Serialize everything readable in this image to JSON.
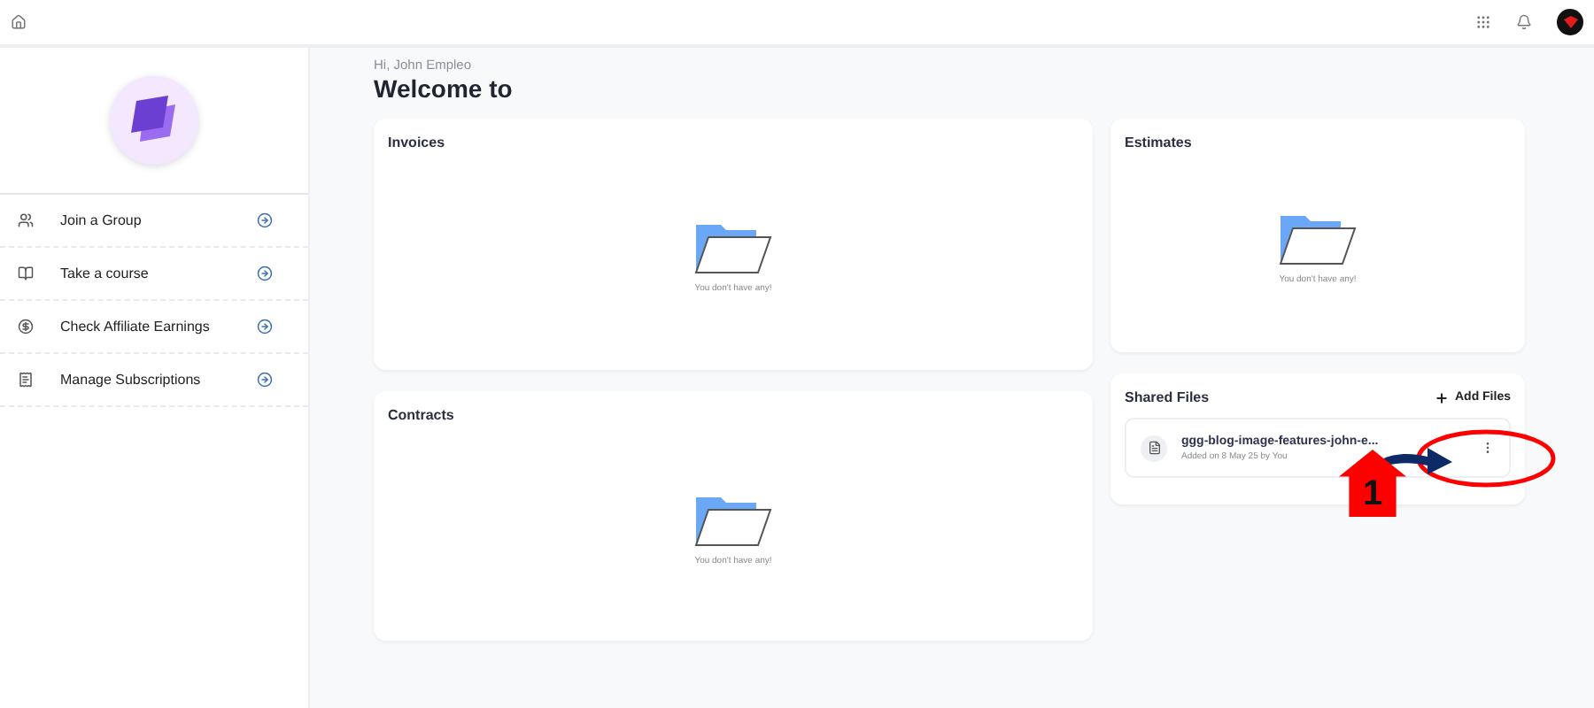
{
  "greeting": "Hi, John Empleo",
  "title": "Welcome to",
  "sidebar": {
    "items": [
      {
        "label": "Join a Group",
        "kind": "group"
      },
      {
        "label": "Take a course",
        "kind": "course"
      },
      {
        "label": "Check Affiliate Earnings",
        "kind": "earnings"
      },
      {
        "label": "Manage Subscriptions",
        "kind": "subscriptions"
      }
    ]
  },
  "cards": [
    {
      "title": "Invoices",
      "empty_text": "You don't have any!"
    },
    {
      "title": "Contracts",
      "empty_text": "You don't have any!"
    },
    {
      "title": "Estimates",
      "empty_text": "You don't have any!"
    }
  ],
  "shared_files": {
    "title": "Shared Files",
    "add_label": "Add Files",
    "files": [
      {
        "name": "ggg-blog-image-features-john-e...",
        "meta": "Added on 8 May 25 by You"
      }
    ]
  },
  "annotation": {
    "step": "1"
  }
}
